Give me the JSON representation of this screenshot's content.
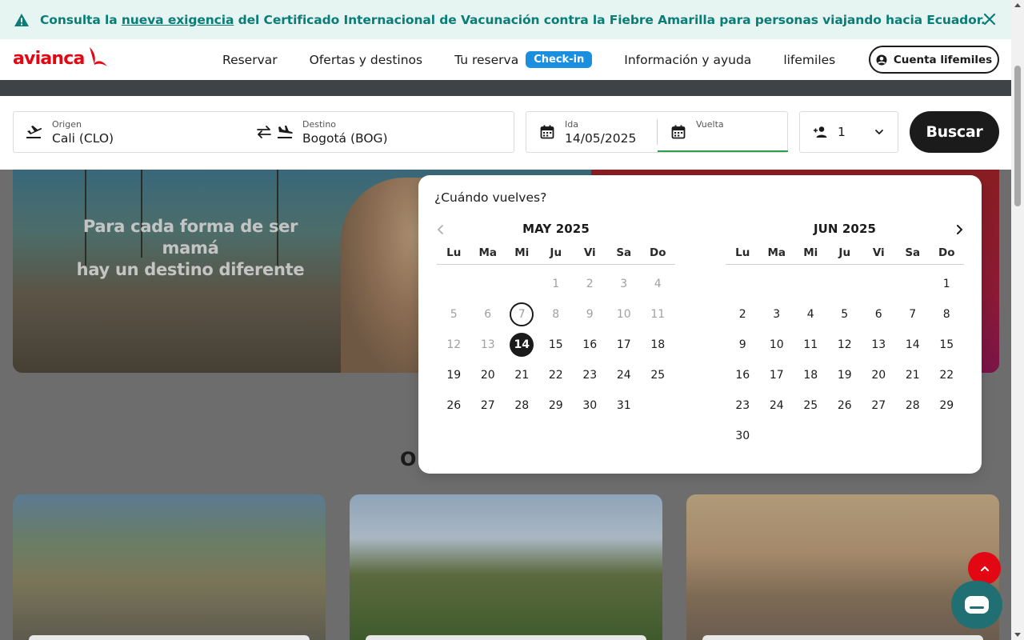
{
  "alert": {
    "prefix": "Consulta la ",
    "link": "nueva exigencia",
    "suffix": " del Certificado Internacional de Vacunación contra la Fiebre Amarilla para personas viajando hacia Ecuador."
  },
  "header": {
    "logo": "avianca",
    "nav": {
      "reservar": "Reservar",
      "ofertas": "Ofertas y destinos",
      "tu_reserva": "Tu reserva",
      "checkin": "Check-in",
      "info": "Información y ayuda",
      "lifemiles": "lifemiles"
    },
    "account": "Cuenta lifemiles"
  },
  "search": {
    "origin_label": "Origen",
    "origin_value": "Cali  (CLO)",
    "dest_label": "Destino",
    "dest_value": "Bogotá  (BOG)",
    "ida_label": "Ida",
    "ida_value": "14/05/2025",
    "vuelta_label": "Vuelta",
    "vuelta_value": "",
    "passengers": "1",
    "button": "Buscar"
  },
  "hero": {
    "line1": "Para cada forma de ser mamá",
    "line2": "hay un destino diferente"
  },
  "section_peek": "O",
  "calendar": {
    "title": "¿Cuándo vuelves?",
    "weekdays": [
      "Lu",
      "Ma",
      "Mi",
      "Ju",
      "Vi",
      "Sa",
      "Do"
    ],
    "months": [
      {
        "title": "MAY 2025",
        "offset": 3,
        "days": 31,
        "disabled_through": 13,
        "today": 7,
        "selected": 14
      },
      {
        "title": "JUN 2025",
        "offset": 6,
        "days": 30,
        "disabled_through": 0,
        "today": 0,
        "selected": 0
      }
    ]
  },
  "colors": {
    "brand_red": "#e30613",
    "alert_text": "#0a7d77",
    "checkin_blue": "#1a8fe0",
    "focus_green": "#2e9d4e"
  }
}
